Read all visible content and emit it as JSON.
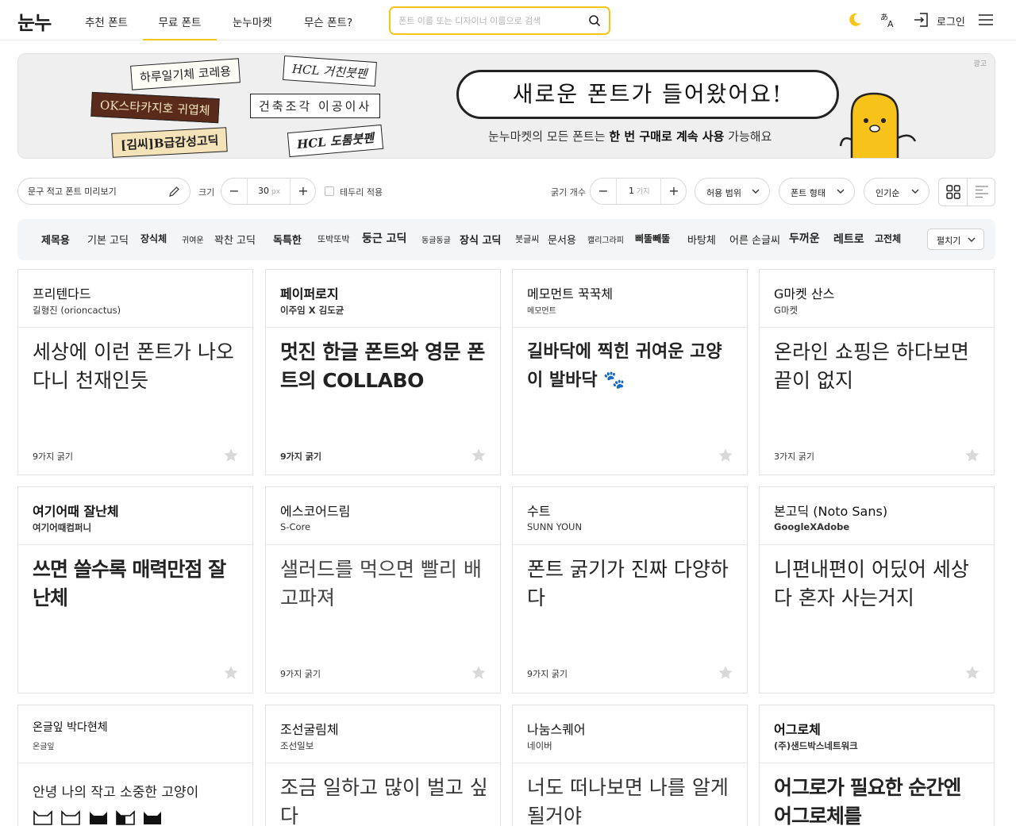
{
  "header": {
    "logo": "눈누",
    "nav": [
      "추천 폰트",
      "무료 폰트",
      "눈누마켓",
      "무슨 폰트?"
    ],
    "active_nav": 1,
    "search_placeholder": "폰트 이름 또는 디자이너 이름으로 검색",
    "login_label": "로그인"
  },
  "banner": {
    "ad_tag": "광고",
    "stickers": [
      "하루일기체 코레용",
      "OK스타카지호 귀엽체",
      "[김씨]B급감성고딕",
      "HCL 거친붓펜",
      "건축조각 이공이사",
      "HCL 도톰붓펜"
    ],
    "headline": "새로운 폰트가 들어왔어요!",
    "sub_pre": "눈누마켓의 모든 폰트는 ",
    "sub_b1": "한 번 구매로 계속 사용",
    "sub_post": " 가능해요"
  },
  "toolbar": {
    "preview_placeholder": "문구 적고 폰트 미리보기",
    "size_label": "크기",
    "size_value": "30",
    "size_unit": "px",
    "border_label": "테두리 적용",
    "weight_count_label": "굵기 개수",
    "weight_count_value": "1",
    "weight_count_unit": "가지",
    "license_label": "허용 범위",
    "shape_label": "폰트 형태",
    "sort_label": "인기순"
  },
  "categories": [
    "제목용",
    "기본 고딕",
    "장식체",
    "귀여운",
    "꽉찬 고딕",
    "독특한",
    "또박또박",
    "둥근 고딕",
    "동글동글",
    "장식 고딕",
    "붓글씨",
    "문서용",
    "캘리그라피",
    "삐뚤빼뚤",
    "바탕체",
    "어른 손글씨",
    "두꺼운",
    "레트로",
    "고전체"
  ],
  "expand_label": "펼치기",
  "cards": [
    {
      "name": "프리텐다드",
      "author": "길형진 (orioncactus)",
      "sample": "세상에 이런 폰트가 나오다니 천재인듯",
      "weights": "9가지 굵기"
    },
    {
      "name": "페이퍼로지",
      "author": "이주임 X 김도균",
      "sample": "멋진 한글 폰트와 영문 폰트의 COLLABO",
      "weights": "9가지 굵기"
    },
    {
      "name": "메모먼트 꾹꾹체",
      "author": "메모먼트",
      "sample": "길바닥에 찍힌 귀여운 고양이 발바닥 🐾",
      "weights": ""
    },
    {
      "name": "G마켓 산스",
      "author": "G마켓",
      "sample": "온라인 쇼핑은 하다보면 끝이 없지",
      "weights": "3가지 굵기"
    },
    {
      "name": "여기어때 잘난체",
      "author": "여기어때컴퍼니",
      "sample": "쓰면 쓸수록 매력만점 잘난체",
      "weights": ""
    },
    {
      "name": "에스코어드림",
      "author": "S-Core",
      "sample": "샐러드를 먹으면 빨리 배고파져",
      "weights": "9가지 굵기"
    },
    {
      "name": "수트",
      "author": "SUNN YOUN",
      "sample": "폰트 굵기가 진짜 다양하다",
      "weights": "9가지 굵기"
    },
    {
      "name": "본고딕 (Noto Sans)",
      "author": "GoogleXAdobe",
      "sample": "니편내편이 어딨어 세상 다 혼자 사는거지",
      "weights": ""
    },
    {
      "name": "온글잎 박다현체",
      "author": "온글잎",
      "sample": "안녕 나의 작고 소중한 고양이",
      "weights": ""
    },
    {
      "name": "조선굴림체",
      "author": "조선일보",
      "sample": "조금 일하고 많이 벌고 싶다",
      "weights": ""
    },
    {
      "name": "나눔스퀘어",
      "author": "네이버",
      "sample": "너도 떠나보면 나를 알게 될거야",
      "weights": ""
    },
    {
      "name": "어그로체",
      "author": "(주)샌드박스네트워크",
      "sample": "어그로가 필요한 순간엔 어그로체를",
      "weights": ""
    }
  ],
  "colors": {
    "accent": "#f5c518",
    "moon": "#f5c518",
    "star": "#d9d9d9",
    "mascot": "#f7c21a"
  }
}
